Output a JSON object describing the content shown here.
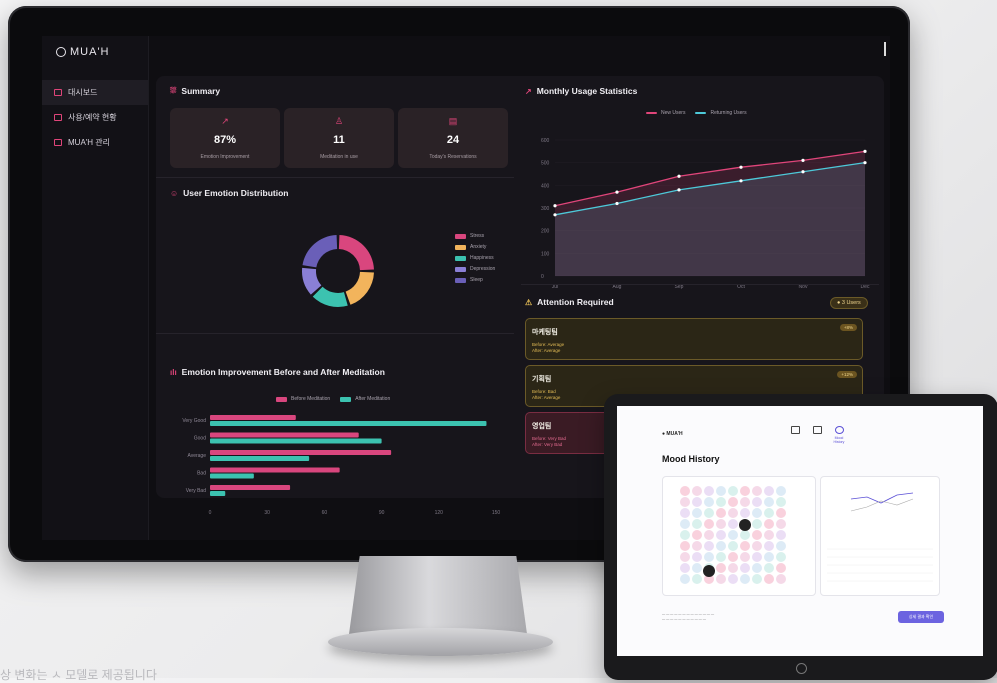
{
  "brand": "MUA'H",
  "sidebar": {
    "items": [
      {
        "label": "대시보드",
        "active": true
      },
      {
        "label": "사용/예약 현황",
        "active": false
      },
      {
        "label": "MUA'H 관리",
        "active": false
      }
    ]
  },
  "summary": {
    "title": "Summary",
    "cards": [
      {
        "icon": "trend-up-icon",
        "value": "87%",
        "label": "Emotion Improvement"
      },
      {
        "icon": "meditation-icon",
        "value": "11",
        "label": "Meditation in use"
      },
      {
        "icon": "calendar-icon",
        "value": "24",
        "label": "Today's Reservations"
      }
    ]
  },
  "emotion_distribution": {
    "title": "User Emotion Distribution",
    "legend": [
      "Stress",
      "Anxiety",
      "Happiness",
      "Depression",
      "Sleep"
    ]
  },
  "improvement": {
    "title": "Emotion Improvement Before and After Meditation",
    "legend": [
      "Before Meditation",
      "After Meditation"
    ]
  },
  "usage": {
    "title": "Monthly Usage Statistics",
    "legend": [
      "New Users",
      "Returning Users"
    ]
  },
  "attention": {
    "title": "Attention Required",
    "badge": "3 Users",
    "items": [
      {
        "name": "마케팅팀",
        "before": "Before: Average",
        "after": "After: Average",
        "pct": "+8%",
        "tone": "warn"
      },
      {
        "name": "기획팀",
        "before": "Before: Bad",
        "after": "After: Average",
        "pct": "+12%",
        "tone": "warn"
      },
      {
        "name": "영업팀",
        "before": "Before: Very Bad",
        "after": "After: Very Bad",
        "pct": "",
        "tone": "bad"
      }
    ]
  },
  "chart_data": [
    {
      "type": "pie",
      "title": "User Emotion Distribution",
      "labels": [
        "Stress",
        "Anxiety",
        "Happiness",
        "Depression",
        "Sleep"
      ],
      "values": [
        25,
        20,
        18,
        14,
        23
      ],
      "colors": [
        "#d9467e",
        "#f2b45c",
        "#3cc2b0",
        "#8a7fd6",
        "#6a5fb8"
      ]
    },
    {
      "type": "bar",
      "orientation": "horizontal",
      "title": "Emotion Improvement Before and After Meditation",
      "categories": [
        "Very Good",
        "Good",
        "Average",
        "Bad",
        "Very Bad"
      ],
      "series": [
        {
          "name": "Before Meditation",
          "values": [
            45,
            78,
            95,
            68,
            42
          ],
          "color": "#d9467e"
        },
        {
          "name": "After Meditation",
          "values": [
            145,
            90,
            52,
            23,
            8
          ],
          "color": "#3cc2b0"
        }
      ],
      "xlim": [
        0,
        150
      ],
      "xticks": [
        "0",
        "30",
        "60",
        "90",
        "120",
        "150"
      ]
    },
    {
      "type": "line",
      "title": "Monthly Usage Statistics",
      "categories": [
        "Jul",
        "Aug",
        "Sep",
        "Oct",
        "Nov",
        "Dec"
      ],
      "series": [
        {
          "name": "New Users",
          "values": [
            310,
            370,
            440,
            480,
            510,
            550
          ],
          "color": "#e0457a"
        },
        {
          "name": "Returning Users",
          "values": [
            270,
            320,
            380,
            420,
            460,
            500
          ],
          "color": "#4dc9d9"
        }
      ],
      "ylim": [
        0,
        600
      ],
      "yticks": [
        "0",
        "100",
        "200",
        "300",
        "400",
        "500",
        "600"
      ]
    }
  ],
  "tablet": {
    "logo": "MUA'H",
    "title": "Mood History",
    "nav": [
      "",
      "",
      "Mood History"
    ],
    "button": "상세 결과 확인"
  },
  "caption": "상 변화는 ㅅ 모델로 제공됩니다"
}
